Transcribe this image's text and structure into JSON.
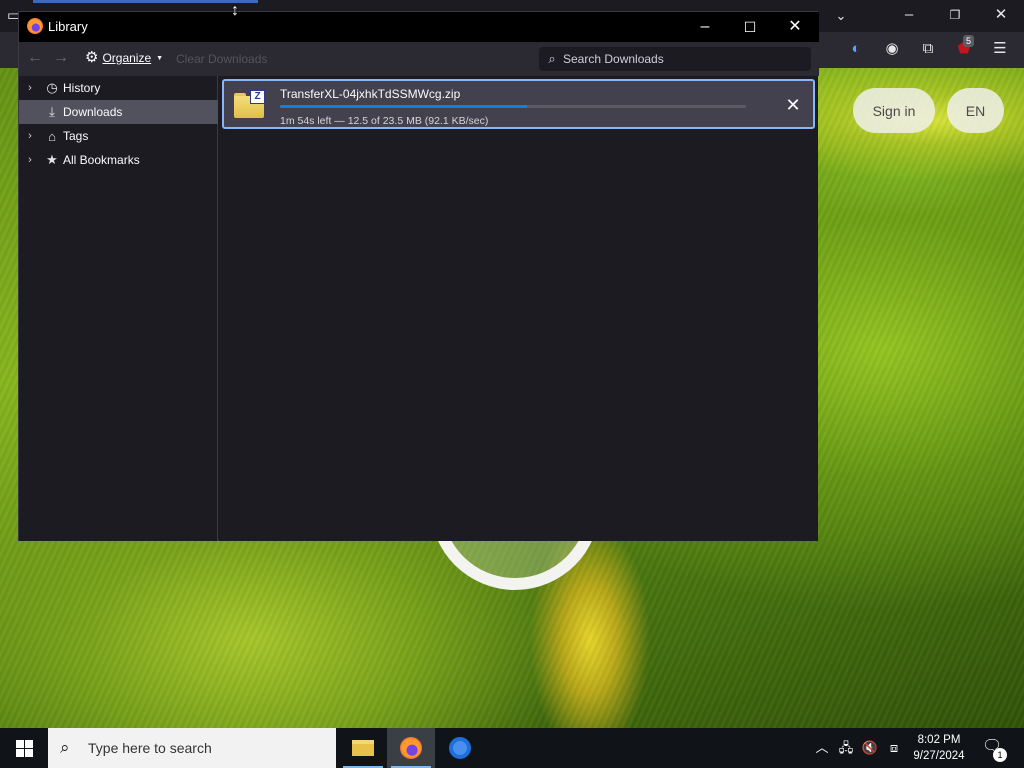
{
  "browser": {
    "page": {
      "sign_in_label": "Sign in",
      "language_label": "EN"
    },
    "toolbar": {
      "extension_badge_count": "5",
      "icons": [
        "tab-list-icon",
        "list-all-tabs-icon",
        "minimize-icon",
        "restore-icon",
        "close-icon",
        "dark-reader-icon",
        "account-icon",
        "extensions-icon",
        "ublock-icon",
        "menu-icon"
      ]
    }
  },
  "library": {
    "title": "Library",
    "toolbar": {
      "organize_label": "Organize",
      "clear_downloads_label": "Clear Downloads",
      "search_placeholder": "Search Downloads"
    },
    "sidebar": {
      "items": [
        {
          "label": "History",
          "icon": "clock-icon",
          "expandable": true
        },
        {
          "label": "Downloads",
          "icon": "download-icon",
          "expandable": false,
          "selected": true
        },
        {
          "label": "Tags",
          "icon": "tag-icon",
          "expandable": true
        },
        {
          "label": "All Bookmarks",
          "icon": "star-icon",
          "expandable": true
        }
      ]
    },
    "downloads": [
      {
        "filename": "TransferXL-04jxhkTdSSMWcg.zip",
        "status": "1m 54s left — 12.5 of 23.5 MB (92.1 KB/sec)",
        "progress": 0.53
      }
    ]
  },
  "taskbar": {
    "search_placeholder": "Type here to search",
    "apps": [
      "file-explorer-icon",
      "firefox-icon",
      "chrome-icon"
    ],
    "time": "8:02 PM",
    "date": "9/27/2024",
    "notification_count": "1"
  },
  "colors": {
    "accent": "#0b82e6",
    "selection_border": "#8ab4f8",
    "window_bg": "#1c1b22",
    "toolbar_bg": "#2b2a33"
  }
}
